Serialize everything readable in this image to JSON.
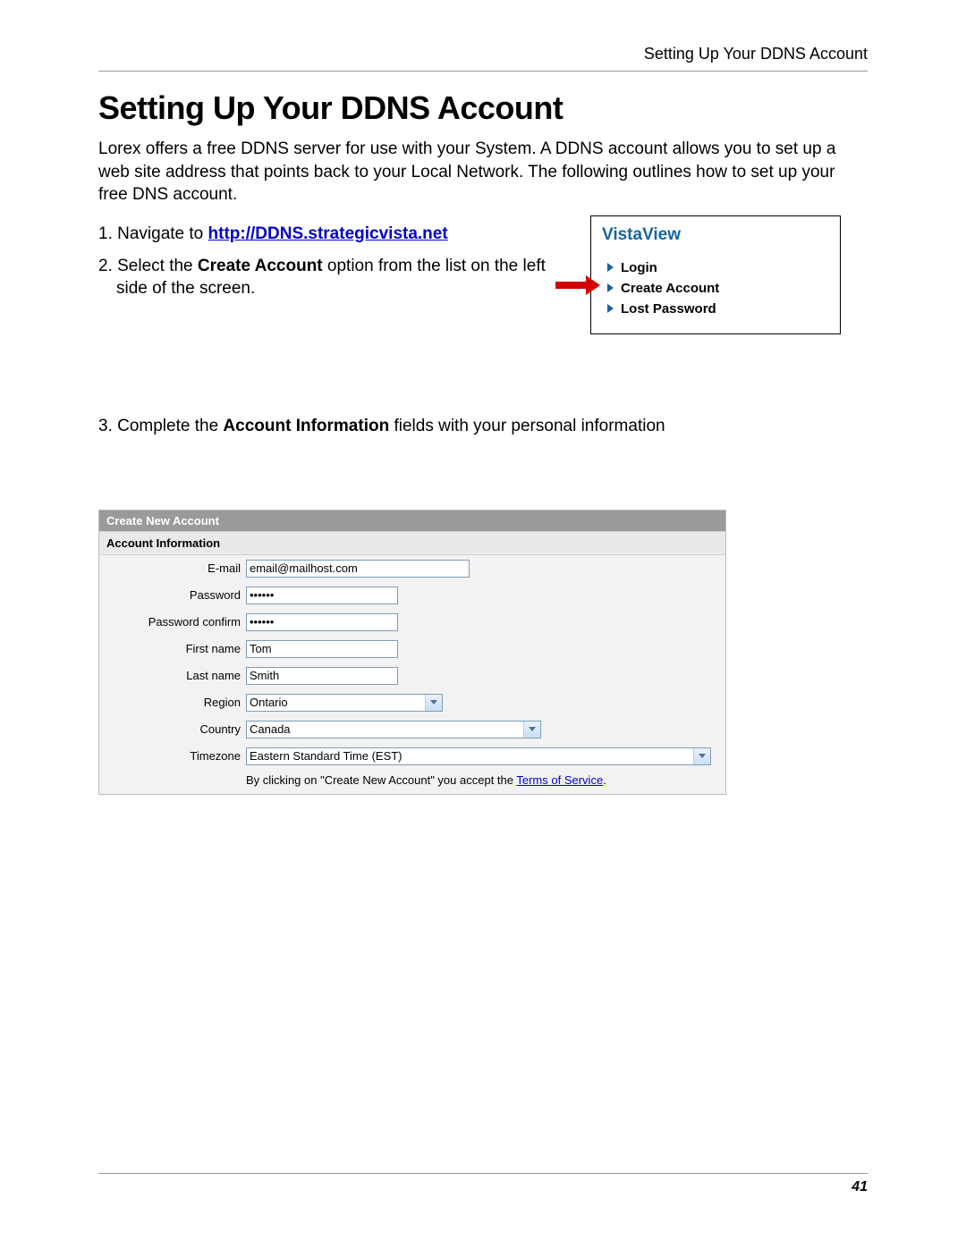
{
  "header": {
    "section": "Setting Up Your DDNS Account"
  },
  "title": "Setting Up Your DDNS Account",
  "intro": "Lorex offers a free DDNS server for use with your System. A DDNS account allows you to set up a web site address that points back to your Local Network. The following outlines how to set up your free DNS account.",
  "steps": {
    "s1_prefix": "1. Navigate to ",
    "s1_link": "http://DDNS.strategicvista.net",
    "s2_prefix": "2. Select the ",
    "s2_bold": "Create Account",
    "s2_suffix": " option from the list on the left side of the screen.",
    "s3_prefix": "3. Complete the ",
    "s3_bold": "Account Information",
    "s3_suffix": " fields with your personal information"
  },
  "vista": {
    "title": "VistaView",
    "items": [
      "Login",
      "Create Account",
      "Lost Password"
    ]
  },
  "form": {
    "header": "Create New Account",
    "subheader": "Account Information",
    "fields": {
      "email_label": "E-mail",
      "email_value": "email@mailhost.com",
      "password_label": "Password",
      "password_value": "••••••",
      "password_confirm_label": "Password confirm",
      "password_confirm_value": "••••••",
      "firstname_label": "First name",
      "firstname_value": "Tom",
      "lastname_label": "Last name",
      "lastname_value": "Smith",
      "region_label": "Region",
      "region_value": "Ontario",
      "country_label": "Country",
      "country_value": "Canada",
      "timezone_label": "Timezone",
      "timezone_value": "Eastern Standard Time (EST)"
    },
    "tos_prefix": "By clicking on \"Create New Account\" you accept the ",
    "tos_link": "Terms of Service",
    "tos_suffix": "."
  },
  "page_number": "41"
}
